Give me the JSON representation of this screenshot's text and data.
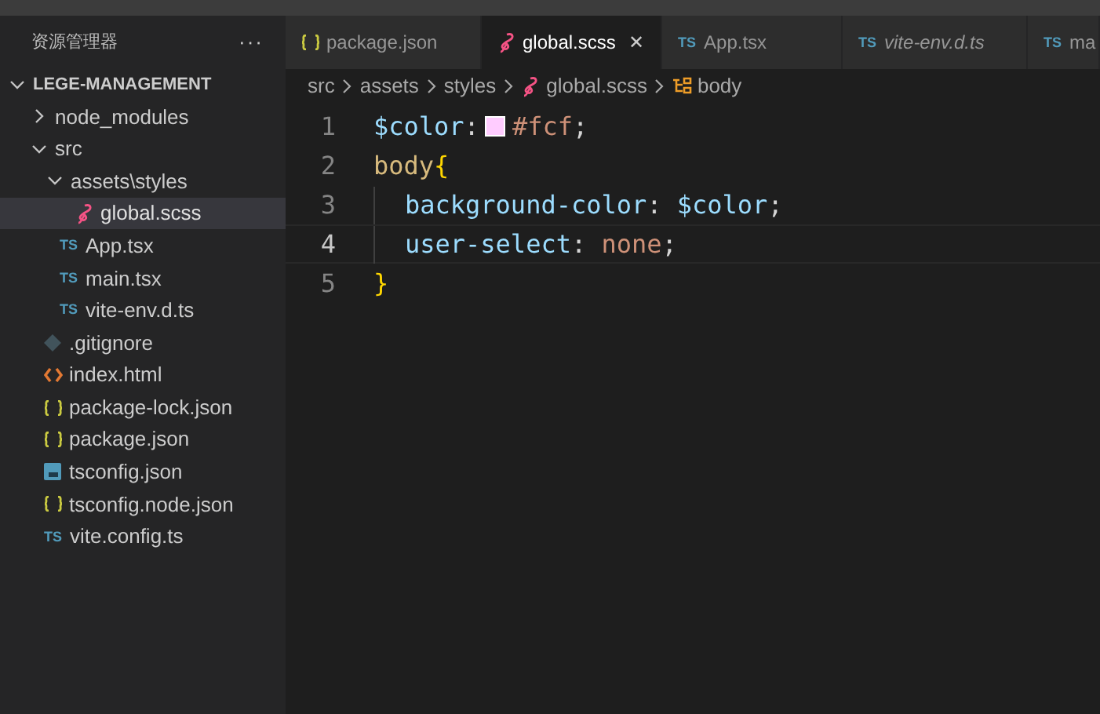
{
  "explorer": {
    "title": "资源管理器",
    "more": "···",
    "root": {
      "label": "LEGE-MANAGEMENT",
      "expanded": true
    },
    "tree": [
      {
        "label": "node_modules",
        "kind": "folder",
        "expanded": false,
        "selected": false
      },
      {
        "label": "src",
        "kind": "folder",
        "expanded": true,
        "selected": false,
        "children": [
          {
            "label": "assets\\styles",
            "kind": "folder",
            "expanded": true,
            "selected": false,
            "children": [
              {
                "label": "global.scss",
                "kind": "scss",
                "selected": true
              }
            ]
          },
          {
            "label": "App.tsx",
            "kind": "ts",
            "badge": "TS",
            "selected": false
          },
          {
            "label": "main.tsx",
            "kind": "ts",
            "badge": "TS",
            "selected": false
          },
          {
            "label": "vite-env.d.ts",
            "kind": "ts",
            "badge": "TS",
            "selected": false
          }
        ]
      },
      {
        "label": ".gitignore",
        "kind": "git",
        "selected": false
      },
      {
        "label": "index.html",
        "kind": "html",
        "selected": false
      },
      {
        "label": "package-lock.json",
        "kind": "json",
        "selected": false
      },
      {
        "label": "package.json",
        "kind": "json",
        "selected": false
      },
      {
        "label": "tsconfig.json",
        "kind": "tsconfig",
        "selected": false
      },
      {
        "label": "tsconfig.node.json",
        "kind": "json",
        "selected": false
      },
      {
        "label": "vite.config.ts",
        "kind": "ts",
        "badge": "TS",
        "selected": false
      }
    ]
  },
  "tabs": [
    {
      "label": "package.json",
      "kind": "json",
      "selected": false,
      "italic": false
    },
    {
      "label": "global.scss",
      "kind": "scss",
      "selected": true,
      "italic": false,
      "close": "✕"
    },
    {
      "label": "App.tsx",
      "kind": "ts",
      "badge": "TS",
      "selected": false,
      "italic": false
    },
    {
      "label": "vite-env.d.ts",
      "kind": "ts",
      "badge": "TS",
      "selected": false,
      "italic": true
    },
    {
      "label": "ma",
      "kind": "ts",
      "badge": "TS",
      "selected": false,
      "italic": false
    }
  ],
  "breadcrumb": [
    {
      "label": "src",
      "kind": "folder"
    },
    {
      "label": "assets",
      "kind": "folder"
    },
    {
      "label": "styles",
      "kind": "folder"
    },
    {
      "label": "global.scss",
      "kind": "scss"
    },
    {
      "label": "body",
      "kind": "symbol"
    }
  ],
  "editor": {
    "lines": [
      {
        "number": "1",
        "current": false,
        "tokens": [
          {
            "text": "$color",
            "kind": "variable"
          },
          {
            "text": ":",
            "kind": "punct"
          },
          {
            "kind": "swatch",
            "color": "#ffccff"
          },
          {
            "text": "#fcf",
            "kind": "value"
          },
          {
            "text": ";",
            "kind": "punct"
          }
        ]
      },
      {
        "number": "2",
        "current": false,
        "tokens": [
          {
            "text": "body",
            "kind": "selector"
          },
          {
            "text": "{",
            "kind": "brace"
          }
        ]
      },
      {
        "number": "3",
        "current": false,
        "tokens": [
          {
            "kind": "indent"
          },
          {
            "text": "background-color",
            "kind": "property"
          },
          {
            "text": ": ",
            "kind": "punct"
          },
          {
            "text": "$color",
            "kind": "variable"
          },
          {
            "text": ";",
            "kind": "punct"
          }
        ]
      },
      {
        "number": "4",
        "current": true,
        "tokens": [
          {
            "kind": "indent"
          },
          {
            "text": "user-select",
            "kind": "property"
          },
          {
            "text": ": ",
            "kind": "punct"
          },
          {
            "text": "none",
            "kind": "value"
          },
          {
            "text": ";",
            "kind": "punct"
          }
        ]
      },
      {
        "number": "5",
        "current": false,
        "tokens": [
          {
            "text": "}",
            "kind": "brace"
          }
        ]
      }
    ]
  }
}
